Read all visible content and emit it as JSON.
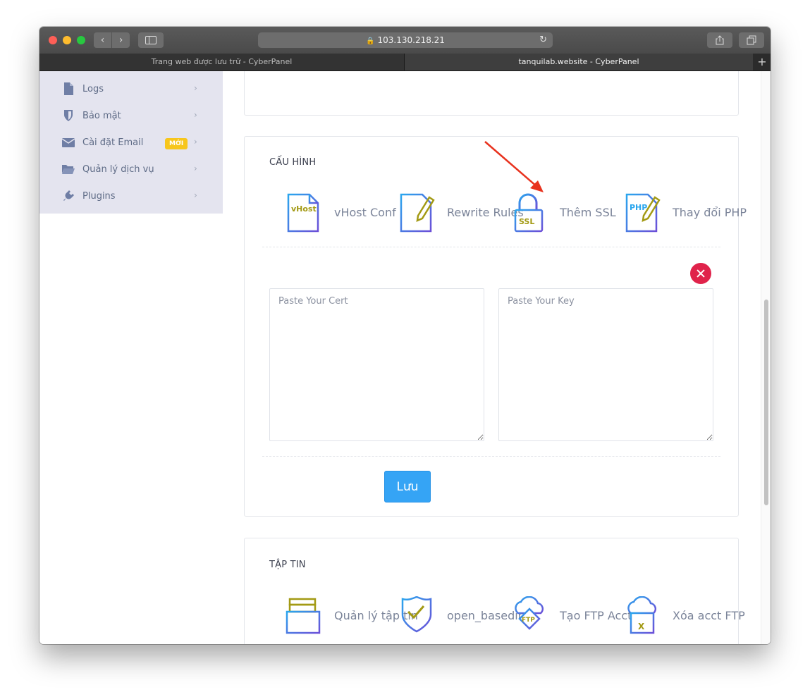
{
  "browser": {
    "url": "103.130.218.21",
    "tabs": [
      {
        "label": "Trang web được lưu trữ - CyberPanel",
        "active": false
      },
      {
        "label": "tanquilab.website - CyberPanel",
        "active": true
      }
    ]
  },
  "sidebar": {
    "items": [
      {
        "label": "Logs",
        "icon": "file-icon"
      },
      {
        "label": "Bảo mật",
        "icon": "shield-icon"
      },
      {
        "label": "Cài đặt Email",
        "icon": "envelope-icon",
        "badge": "MỚI"
      },
      {
        "label": "Quản lý dịch vụ",
        "icon": "folder-open-icon"
      },
      {
        "label": "Plugins",
        "icon": "plug-icon"
      }
    ]
  },
  "config": {
    "title": "CẤU HÌNH",
    "tools": [
      {
        "label": "vHost Conf",
        "icon_text": "vHost"
      },
      {
        "label": "Rewrite Rules"
      },
      {
        "label": "Thêm SSL",
        "icon_text": "SSL"
      },
      {
        "label": "Thay đổi PHP",
        "icon_text": "PHP"
      }
    ],
    "cert_placeholder": "Paste Your Cert",
    "key_placeholder": "Paste Your Key",
    "save_label": "Lưu"
  },
  "files": {
    "title": "TẬP TIN",
    "tools": [
      {
        "label": "Quản lý tập tin"
      },
      {
        "label": "open_basedir"
      },
      {
        "label": "Tạo FTP Acct",
        "icon_text": "FTP"
      },
      {
        "label": "Xóa acct FTP",
        "icon_text": "X"
      }
    ]
  },
  "colors": {
    "accent": "#35a4f5",
    "danger": "#e0234b",
    "badge": "#f7c61c",
    "annotation_arrow": "#e8321e"
  }
}
